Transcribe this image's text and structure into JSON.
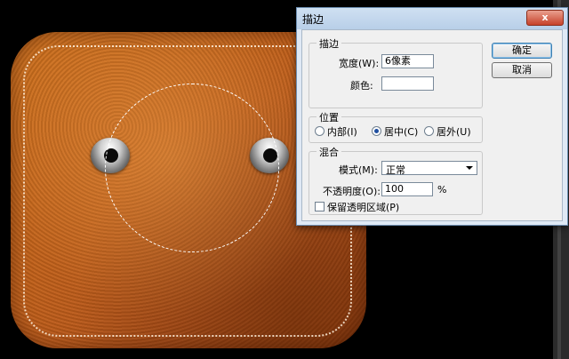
{
  "dialog": {
    "title": "描边",
    "close_label": "x",
    "stroke_group": {
      "title": "描边",
      "width_label": "宽度(W):",
      "width_value": "6",
      "width_unit": "像素",
      "color_label": "颜色:"
    },
    "position_group": {
      "title": "位置",
      "options": [
        "内部(I)",
        "居中(C)",
        "居外(U)"
      ],
      "selected": "居中(C)"
    },
    "blend_group": {
      "title": "混合",
      "mode_label": "模式(M):",
      "mode_value": "正常",
      "opacity_label": "不透明度(O):",
      "opacity_value": "100",
      "opacity_unit": "%",
      "preserve_label": "保留透明区域(P)",
      "preserve_checked": false
    },
    "buttons": {
      "ok": "确定",
      "cancel": "取消"
    }
  },
  "colors": {
    "leather": "#c2611a",
    "dialog_bg": "#f0f0f0",
    "close_button": "#c7422a"
  }
}
